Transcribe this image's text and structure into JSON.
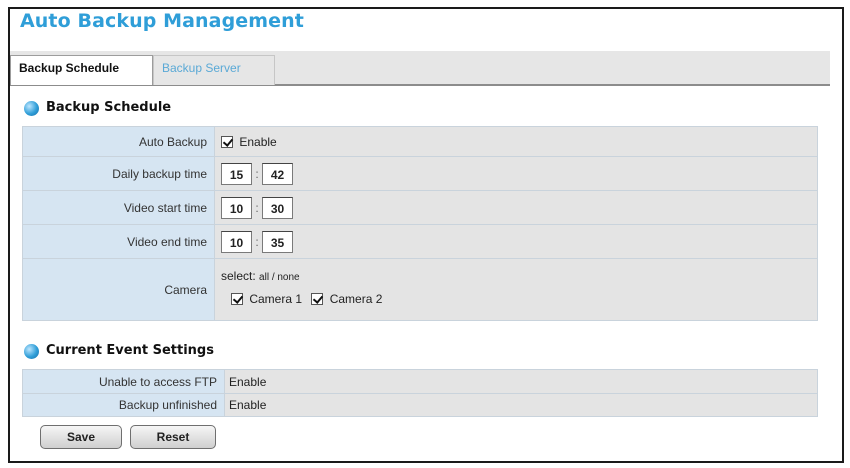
{
  "page": {
    "title": "Auto Backup Management"
  },
  "tabs": [
    {
      "label": "Backup Schedule",
      "active": true
    },
    {
      "label": "Backup Server",
      "active": false
    }
  ],
  "schedule_section": {
    "title": "Backup Schedule",
    "auto_backup": {
      "label": "Auto Backup",
      "checkbox_label": "Enable",
      "checked": true
    },
    "daily_backup_time": {
      "label": "Daily backup time",
      "hour": "15",
      "minute": "42"
    },
    "video_start_time": {
      "label": "Video start time",
      "hour": "10",
      "minute": "30"
    },
    "video_end_time": {
      "label": "Video end time",
      "hour": "10",
      "minute": "35"
    },
    "camera": {
      "label": "Camera",
      "select_label": "select:",
      "select_options": "all / none",
      "items": [
        {
          "label": "Camera 1",
          "checked": true
        },
        {
          "label": "Camera 2",
          "checked": true
        }
      ]
    }
  },
  "event_section": {
    "title": "Current Event Settings",
    "rows": [
      {
        "label": "Unable to access FTP",
        "value": "Enable"
      },
      {
        "label": "Backup unfinished",
        "value": "Enable"
      }
    ]
  },
  "buttons": {
    "save": "Save",
    "reset": "Reset"
  },
  "colors": {
    "accent": "#2f9ed8",
    "label_bg": "#d6e5f2",
    "value_bg": "#e4e4e4"
  }
}
